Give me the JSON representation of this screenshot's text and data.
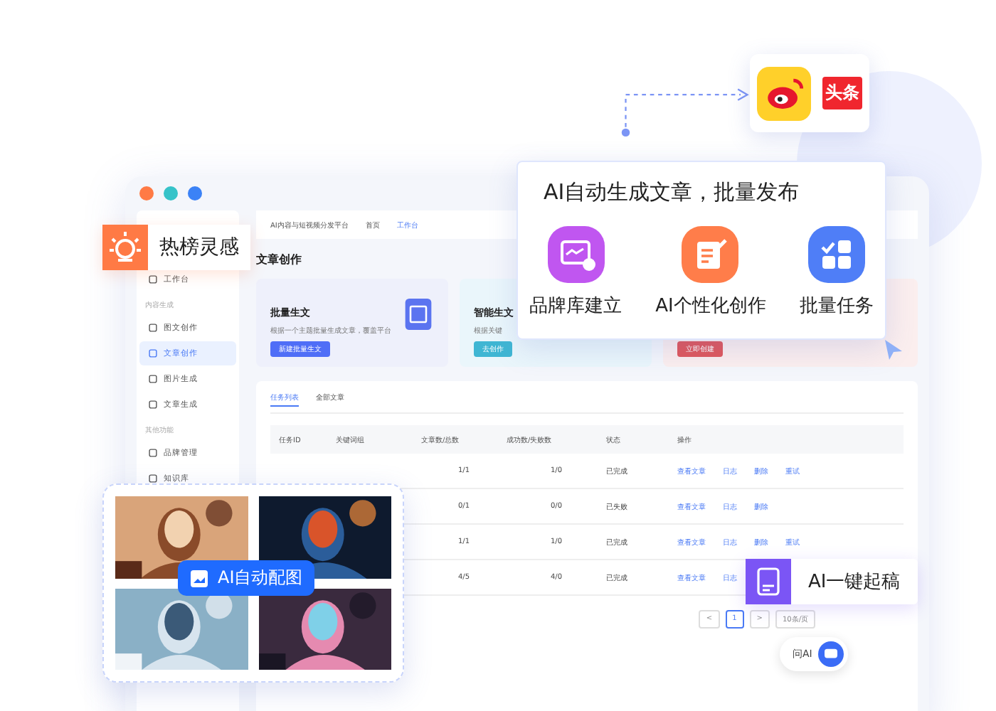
{
  "window": {
    "header_text": "AI内容与短视频分发平台",
    "nav": [
      "首页",
      "工作台"
    ]
  },
  "sidebar": {
    "items": [
      {
        "kind": "item",
        "label": "工作台",
        "selected": false
      },
      {
        "kind": "section",
        "label": "内容生成"
      },
      {
        "kind": "item",
        "label": "图文创作",
        "selected": false
      },
      {
        "kind": "item",
        "label": "文章创作",
        "selected": true
      },
      {
        "kind": "item",
        "label": "图片生成",
        "selected": false
      },
      {
        "kind": "item",
        "label": "文章生成",
        "selected": false
      },
      {
        "kind": "section",
        "label": "其他功能"
      },
      {
        "kind": "item",
        "label": "品牌管理",
        "selected": false
      },
      {
        "kind": "item",
        "label": "知识库",
        "selected": false
      }
    ]
  },
  "page_title": "文章创作",
  "feature_cards": [
    {
      "title": "批量生文",
      "desc": "根据一个主题批量生成文章，覆盖平台",
      "button": "新建批量生文",
      "color": "#4f6ef7"
    },
    {
      "title": "智能生文",
      "desc": "根据关键",
      "button": "去创作",
      "color": "#3fb6d3"
    },
    {
      "button": "立即创建",
      "color": "#e0575b"
    }
  ],
  "tabs": [
    {
      "label": "任务列表",
      "selected": true
    },
    {
      "label": "全部文章",
      "selected": false
    }
  ],
  "table": {
    "columns": [
      "任务ID",
      "关键词组",
      "文章数/总数",
      "成功数/失败数",
      "状态",
      "操作"
    ],
    "rows": [
      {
        "articles": "1/1",
        "results": "1/0",
        "status": "已完成",
        "actions": [
          "查看文章",
          "日志",
          "删除",
          "重试"
        ]
      },
      {
        "articles": "0/1",
        "results": "0/0",
        "status": "已失败",
        "actions": [
          "查看文章",
          "日志",
          "删除"
        ]
      },
      {
        "articles": "1/1",
        "results": "1/0",
        "status": "已完成",
        "actions": [
          "查看文章",
          "日志",
          "删除",
          "重试"
        ]
      },
      {
        "articles": "4/5",
        "results": "4/0",
        "status": "已完成",
        "actions": [
          "查看文章",
          "日志"
        ]
      }
    ]
  },
  "pagination": {
    "prev": "<",
    "page": "1",
    "next": ">",
    "size": "10条/页"
  },
  "ask_ai": "问AI",
  "platforms": {
    "toutiao": "头条"
  },
  "ai_card": {
    "title": "AI自动生成文章，批量发布",
    "features": [
      {
        "kind": "brand",
        "label": "品牌库建立"
      },
      {
        "kind": "personal",
        "label": "AI个性化创作"
      },
      {
        "kind": "batch",
        "label": "批量任务"
      }
    ]
  },
  "hot_tag": "热榜灵感",
  "image_card": {
    "label": "AI自动配图"
  },
  "draft_tag": "AI一键起稿"
}
